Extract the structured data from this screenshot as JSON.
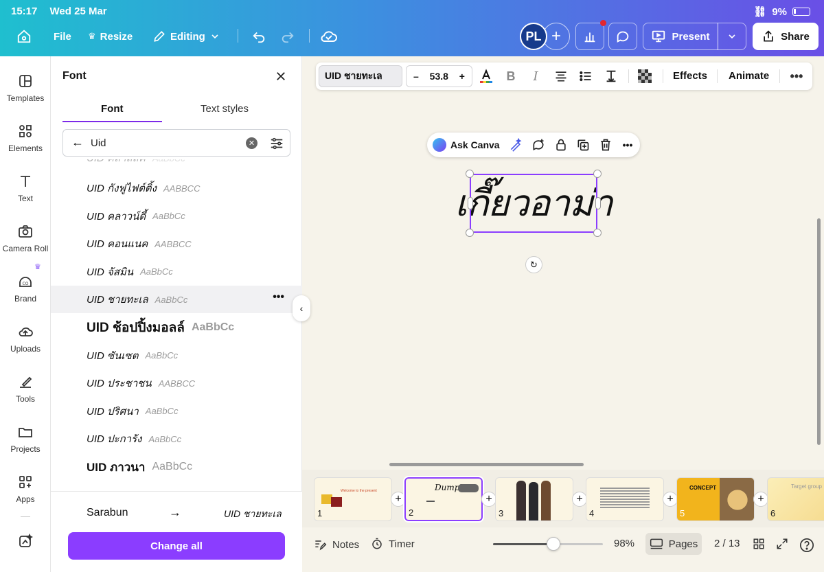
{
  "status_bar": {
    "time": "15:17",
    "date": "Wed 25 Mar",
    "battery": "9%"
  },
  "topbar": {
    "file": "File",
    "resize": "Resize",
    "editing": "Editing",
    "avatar_initials": "PL",
    "present": "Present",
    "share": "Share"
  },
  "rail": {
    "items": [
      {
        "label": "Templates",
        "icon": "templates-icon"
      },
      {
        "label": "Elements",
        "icon": "elements-icon"
      },
      {
        "label": "Text",
        "icon": "text-icon"
      },
      {
        "label": "Camera Roll",
        "icon": "camera-icon"
      },
      {
        "label": "Brand",
        "icon": "brand-icon"
      },
      {
        "label": "Uploads",
        "icon": "upload-icon"
      },
      {
        "label": "Tools",
        "icon": "tools-icon"
      },
      {
        "label": "Projects",
        "icon": "folder-icon"
      },
      {
        "label": "Apps",
        "icon": "apps-icon"
      }
    ]
  },
  "font_panel": {
    "title": "Font",
    "tabs": [
      "Font",
      "Text styles"
    ],
    "active_tab": "Font",
    "search_value": "Uid",
    "fonts": [
      {
        "name": "UID คลาสสิค",
        "sample": "AaBbCc",
        "style": "cut"
      },
      {
        "name": "UID กังฟูไฟต์ติ้ง",
        "sample": "AABBCC",
        "style": ""
      },
      {
        "name": "UID คลาวน์ดี้",
        "sample": "AaBbCc",
        "style": ""
      },
      {
        "name": "UID คอนแนค",
        "sample": "AABBCC",
        "style": ""
      },
      {
        "name": "UID จัสมิน",
        "sample": "AaBbCc",
        "style": ""
      },
      {
        "name": "UID ชายทะเล",
        "sample": "AaBbCc",
        "style": "selected"
      },
      {
        "name": "UID ช้อปปิ้งมอลล์",
        "sample": "AaBbCc",
        "style": "bold"
      },
      {
        "name": "UID ซันเซต",
        "sample": "AaBbCc",
        "style": ""
      },
      {
        "name": "UID ประชาชน",
        "sample": "AABBCC",
        "style": ""
      },
      {
        "name": "UID ปริศนา",
        "sample": "AaBbCc",
        "style": ""
      },
      {
        "name": "UID ปะการัง",
        "sample": "AaBbCc",
        "style": ""
      },
      {
        "name": "UID ภาวนา",
        "sample": "AaBbCc",
        "style": "plain"
      }
    ],
    "replace_from": "Sarabun",
    "replace_to": "UID ชายทะเล",
    "change_all": "Change all"
  },
  "text_toolbar": {
    "font": "UID ชายทะเล",
    "font_size": "53.8",
    "effects": "Effects",
    "animate": "Animate"
  },
  "context_bar": {
    "ask_canva": "Ask Canva"
  },
  "canvas": {
    "text": "เกี๊ยวอาม่า"
  },
  "pages": {
    "thumbnails": [
      {
        "num": "1",
        "caption": "Welcome to the present"
      },
      {
        "num": "2",
        "caption": "Dumpling"
      },
      {
        "num": "3",
        "caption": ""
      },
      {
        "num": "4",
        "caption": ""
      },
      {
        "num": "5",
        "caption": "CONCEPT"
      },
      {
        "num": "6",
        "caption": "Target group"
      }
    ],
    "current": "2 / 13"
  },
  "bottom_bar": {
    "notes": "Notes",
    "timer": "Timer",
    "zoom": "98%",
    "zoom_level": 0.55,
    "pages": "Pages"
  },
  "colors": {
    "accent": "#8b3dff",
    "gradient_start": "#1fbfcf",
    "gradient_end": "#6a4fe6"
  }
}
